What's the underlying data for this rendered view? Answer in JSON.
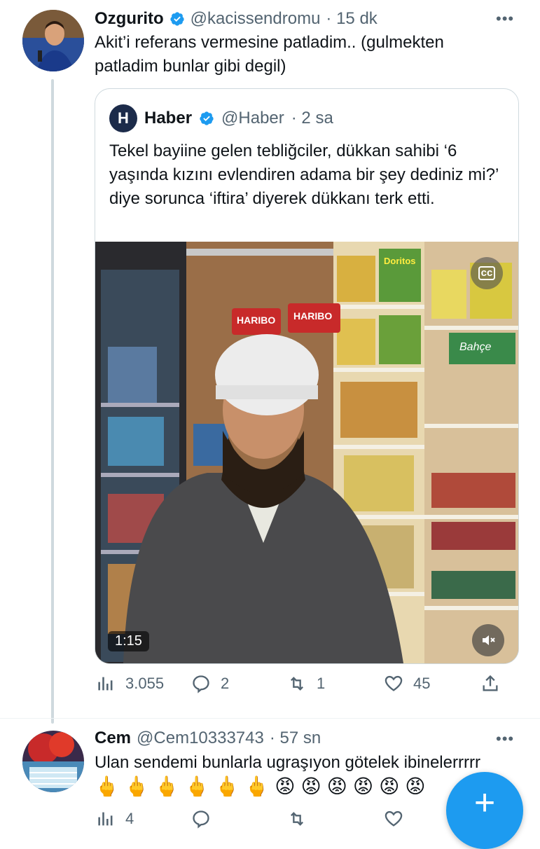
{
  "tweet": {
    "name": "Ozgurito",
    "handle": "@kacissendromu",
    "time": "· 15 dk",
    "text": "Akit’i referans vermesine patladim.. (gulmekten patladim bunlar gibi degil)",
    "more": "•••",
    "quote": {
      "logo_letter": "H",
      "name": "Haber",
      "handle": "@Haber",
      "time": "· 2 sa",
      "text": "Tekel bayiine gelen tebliğciler, dükkan sahibi ‘6 yaşında kızını evlendiren adama bir şey dediniz mi?’ diye sorunca ‘iftira’ diyerek dükkanı terk etti.",
      "video_duration": "1:15",
      "cc_label": "cc",
      "store_signs": [
        "HARIBO",
        "HARIBO",
        "Bahçe",
        "Doritos"
      ]
    },
    "actions": {
      "views": "3.055",
      "replies": "2",
      "retweets": "1",
      "likes": "45"
    }
  },
  "reply": {
    "name": "Cem",
    "handle": "@Cem10333743",
    "time": "· 57 sn",
    "text": "Ulan sendemi bunlarla ugraşıyon götelek ibinelerrrrr",
    "emojis": [
      "🖕",
      "🖕",
      "🖕",
      "🖕",
      "🖕",
      "🖕",
      "😡",
      "😡",
      "😡",
      "😡",
      "😡",
      "😡"
    ],
    "more": "•••",
    "actions": {
      "views": "4"
    }
  },
  "fab_label": "+",
  "colors": {
    "accent": "#1d9bf0",
    "muted": "#536471",
    "border": "#cfd9de"
  }
}
